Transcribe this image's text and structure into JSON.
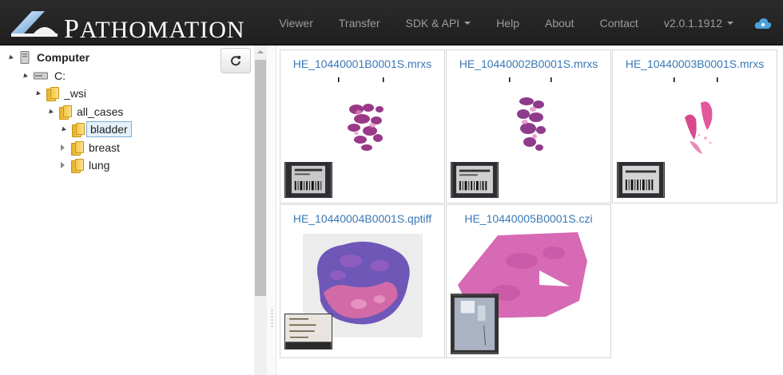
{
  "brand": {
    "name_initial": "P",
    "name_rest": "ATHOMATION"
  },
  "nav": {
    "items": [
      {
        "label": "Viewer",
        "dropdown": false
      },
      {
        "label": "Transfer",
        "dropdown": false
      },
      {
        "label": "SDK & API",
        "dropdown": true
      },
      {
        "label": "Help",
        "dropdown": false
      },
      {
        "label": "About",
        "dropdown": false
      },
      {
        "label": "Contact",
        "dropdown": false
      },
      {
        "label": "v2.0.1.1912",
        "dropdown": true
      }
    ],
    "cloud_icon": "cloud-icon"
  },
  "tree": {
    "nodes": [
      {
        "label": "Computer",
        "icon": "computer-icon",
        "state": "open"
      },
      {
        "label": "C:",
        "icon": "drive-icon",
        "state": "open"
      },
      {
        "label": "_wsi",
        "icon": "folder-icon",
        "state": "open"
      },
      {
        "label": "all_cases",
        "icon": "folder-icon",
        "state": "open"
      },
      {
        "label": "bladder",
        "icon": "folder-icon",
        "state": "open",
        "selected": true
      },
      {
        "label": "breast",
        "icon": "folder-icon",
        "state": "closed"
      },
      {
        "label": "lung",
        "icon": "folder-icon",
        "state": "closed"
      }
    ],
    "refresh_icon": "refresh-icon"
  },
  "slides": [
    {
      "filename": "HE_10440001B0001S.mrxs"
    },
    {
      "filename": "HE_10440002B0001S.mrxs"
    },
    {
      "filename": "HE_10440003B0001S.mrxs"
    },
    {
      "filename": "HE_10440004B0001S.qptiff"
    },
    {
      "filename": "HE_10440005B0001S.czi"
    }
  ],
  "colors": {
    "navbar": "#222222",
    "link": "#3a78b5",
    "tissue_dark": "#8b2c7a",
    "tissue_light": "#e27fb6"
  }
}
